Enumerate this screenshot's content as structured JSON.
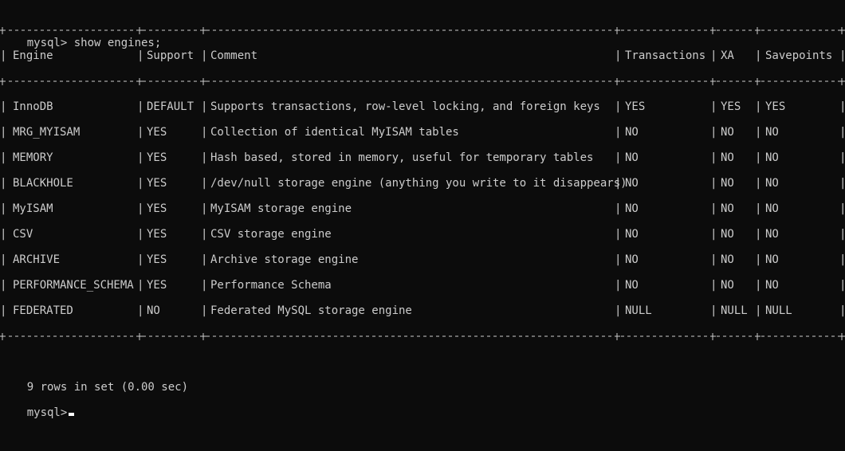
{
  "terminal": {
    "command": "mysql> show engines;",
    "columns": [
      "Engine",
      "Support",
      "Comment",
      "Transactions",
      "XA",
      "Savepoints"
    ],
    "rows": [
      [
        "InnoDB",
        "DEFAULT",
        "Supports transactions, row-level locking, and foreign keys",
        "YES",
        "YES",
        "YES"
      ],
      [
        "MRG_MYISAM",
        "YES",
        "Collection of identical MyISAM tables",
        "NO",
        "NO",
        "NO"
      ],
      [
        "MEMORY",
        "YES",
        "Hash based, stored in memory, useful for temporary tables",
        "NO",
        "NO",
        "NO"
      ],
      [
        "BLACKHOLE",
        "YES",
        "/dev/null storage engine (anything you write to it disappears)",
        "NO",
        "NO",
        "NO"
      ],
      [
        "MyISAM",
        "YES",
        "MyISAM storage engine",
        "NO",
        "NO",
        "NO"
      ],
      [
        "CSV",
        "YES",
        "CSV storage engine",
        "NO",
        "NO",
        "NO"
      ],
      [
        "ARCHIVE",
        "YES",
        "Archive storage engine",
        "NO",
        "NO",
        "NO"
      ],
      [
        "PERFORMANCE_SCHEMA",
        "YES",
        "Performance Schema",
        "NO",
        "NO",
        "NO"
      ],
      [
        "FEDERATED",
        "NO",
        "Federated MySQL storage engine",
        "NULL",
        "NULL",
        "NULL"
      ]
    ],
    "result_summary": "9 rows in set (0.00 sec)",
    "prompt": "mysql>"
  },
  "colors": {
    "background": "#0c0c0c",
    "text": "#cccccc",
    "cursor": "#ffffff"
  }
}
